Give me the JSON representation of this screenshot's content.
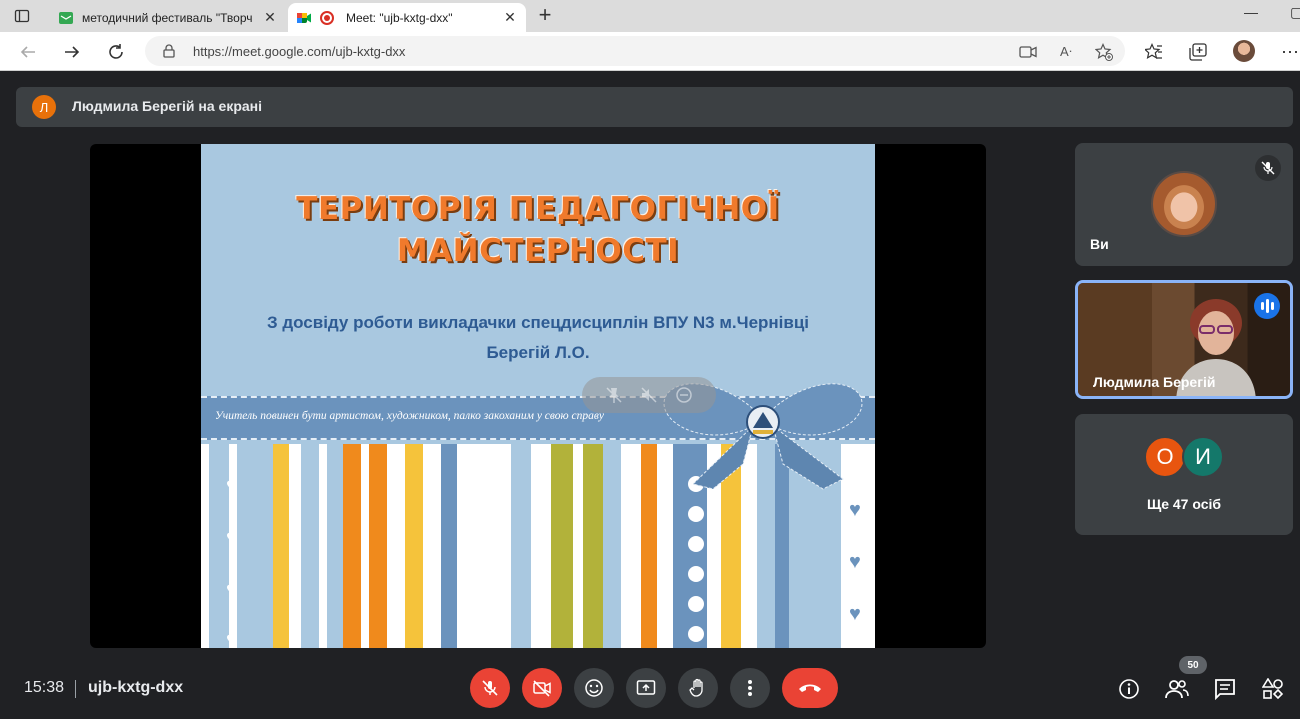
{
  "browser": {
    "tabs": [
      {
        "title": "методичний фестиваль \"Творч",
        "icon": "document-icon",
        "active": false
      },
      {
        "title": "Meet: \"ujb-kxtg-dxx\"",
        "icon": "meet-icon",
        "active": true
      }
    ],
    "url": "https://meet.google.com/ujb-kxtg-dxx"
  },
  "meet": {
    "presenter_banner": {
      "initial": "Л",
      "text": "Людмила Берегій на екрані"
    },
    "slide": {
      "title_line1": "ТЕРИТОРІЯ ПЕДАГОГІЧНОЇ",
      "title_line2": "МАЙСТЕРНОСТІ",
      "subtitle_line1": "З досвіду роботи викладачки спецдисциплін ВПУ N3 м.Чернівці",
      "subtitle_line2": "Берегій Л.О.",
      "motto": "Учитель повинен бути артистом, художником, палко закоханим у свою справу"
    },
    "tiles": {
      "you": {
        "name": "Ви",
        "muted": true
      },
      "speaker": {
        "name": "Людмила Берегій",
        "speaking": true
      },
      "others": {
        "bubbles": [
          "О",
          "И"
        ],
        "label": "Ще 47 осіб"
      }
    },
    "bottom": {
      "time": "15:38",
      "meeting_code": "ujb-kxtg-dxx",
      "participants_count": "50"
    },
    "colors": {
      "accent_red": "#ea4335",
      "speaker_border": "#8ab4f8",
      "bubble_o": "#e8550f",
      "bubble_i": "#14786a"
    }
  }
}
